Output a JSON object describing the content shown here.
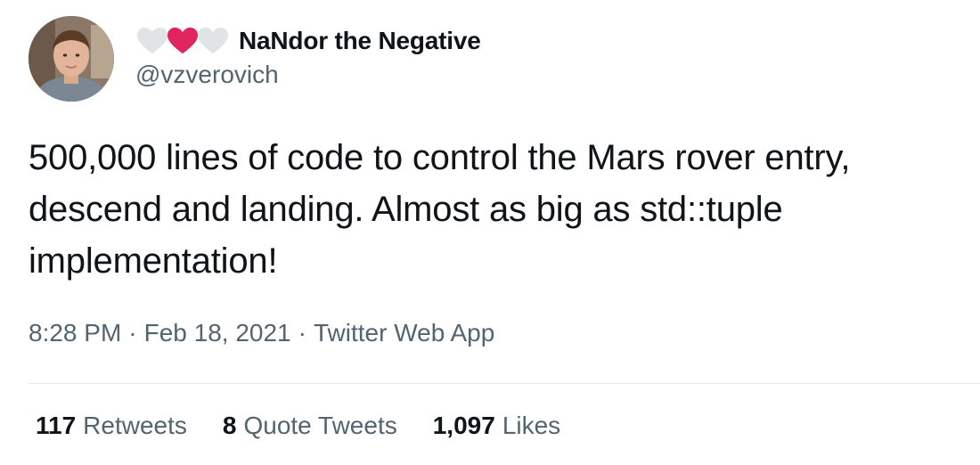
{
  "author": {
    "display_name": "NaNdor the Negative",
    "handle": "@vzverovich",
    "name_prefix_icons": [
      "white-heart-icon",
      "red-heart-icon",
      "white-heart-icon"
    ]
  },
  "tweet": {
    "text": "500,000 lines of code to control the Mars rover entry, descend and landing. Almost as big as std::tuple implementation!",
    "time": "8:28 PM",
    "date": "Feb 18, 2021",
    "source": "Twitter Web App",
    "separator": "·"
  },
  "stats": {
    "retweets": {
      "count": "117",
      "label": "Retweets"
    },
    "quotes": {
      "count": "8",
      "label": "Quote Tweets"
    },
    "likes": {
      "count": "1,097",
      "label": "Likes"
    }
  },
  "colors": {
    "text_primary": "#0f1419",
    "text_secondary": "#536471",
    "heart_red": "#e0245e",
    "heart_white": "#e1e4e7",
    "divider": "#e6e9ec"
  }
}
